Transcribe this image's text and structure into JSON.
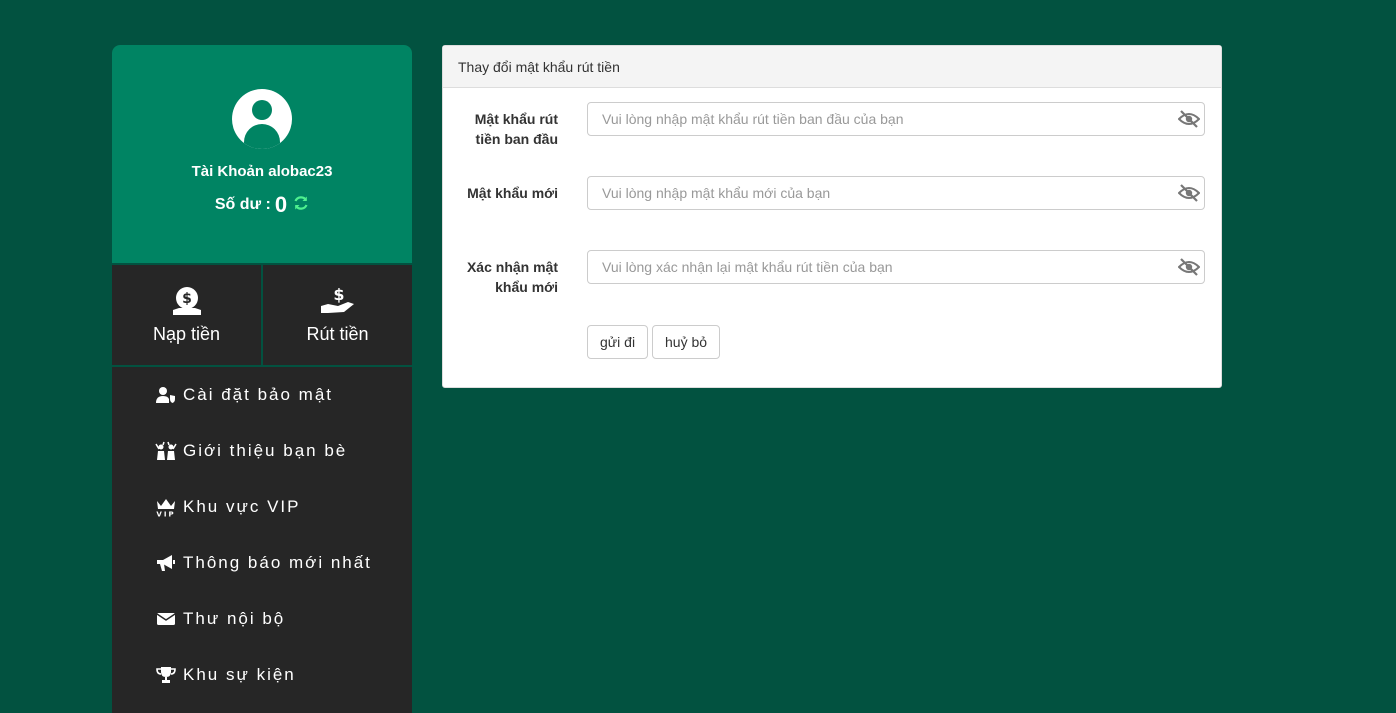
{
  "profile": {
    "account_label": "Tài Khoản alobac23",
    "balance_label": "Số dư :",
    "balance_value": "0"
  },
  "actions": {
    "deposit": "Nạp tiền",
    "withdraw": "Rút tiền"
  },
  "menu": [
    {
      "label": "Cài đặt bảo mật",
      "icon": "user-shield-icon"
    },
    {
      "label": "Giới thiệu bạn bè",
      "icon": "people-cheer-icon"
    },
    {
      "label": "Khu vực VIP",
      "icon": "crown-vip-icon"
    },
    {
      "label": "Thông báo mới nhất",
      "icon": "megaphone-icon"
    },
    {
      "label": "Thư nội bộ",
      "icon": "envelope-icon"
    },
    {
      "label": "Khu sự kiện",
      "icon": "trophy-icon"
    }
  ],
  "panel": {
    "title": "Thay đổi mật khẩu rút tiền",
    "fields": [
      {
        "label": "Mật khẩu rút tiền ban đầu",
        "placeholder": "Vui lòng nhập mật khẩu rút tiền ban đầu của bạn"
      },
      {
        "label": "Mật khẩu mới",
        "placeholder": "Vui lòng nhập mật khẩu mới của bạn"
      },
      {
        "label": "Xác nhận mật khẩu mới",
        "placeholder": "Vui lòng xác nhận lại mật khẩu rút tiền của bạn"
      }
    ],
    "submit_label": "gửi đi",
    "cancel_label": "huỷ bỏ"
  },
  "colors": {
    "background": "#025240",
    "profile_bg": "#008463",
    "sidebar_bg": "#262626",
    "refresh_icon": "#4ef08f"
  }
}
